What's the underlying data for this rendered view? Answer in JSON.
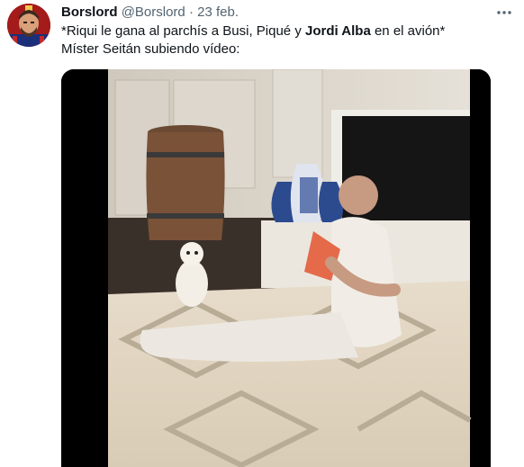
{
  "tweet": {
    "display_name": "Borslord",
    "handle": "@Borslord",
    "separator": "·",
    "date": "23 feb.",
    "text_line1_part1": "*Riqui le gana al parchís a Busi, Piqué y ",
    "text_line1_bold": "Jordi Alba",
    "text_line1_part2": " en el avión*",
    "text_line2": "Míster Seitán subiendo vídeo:"
  },
  "icons": {
    "more": "more-horizontal-icon",
    "avatar": "avatar-image",
    "media": "video-thumbnail"
  },
  "colors": {
    "text": "#0f1419",
    "secondary": "#536471",
    "background": "#ffffff"
  }
}
